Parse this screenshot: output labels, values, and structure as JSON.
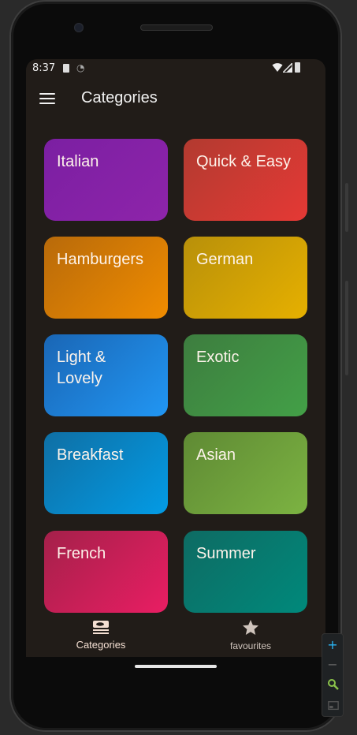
{
  "status_bar": {
    "time": "8:37"
  },
  "app_bar": {
    "title": "Categories",
    "menu_icon": "hamburger-menu-icon"
  },
  "categories": [
    {
      "label": "Italian",
      "color_from": "#7b1fa2",
      "color_to": "#8e24aa"
    },
    {
      "label": "Quick & Easy",
      "color_from": "#b23a30",
      "color_to": "#e53935"
    },
    {
      "label": "Hamburgers",
      "color_from": "#b86a0a",
      "color_to": "#f08c00"
    },
    {
      "label": "German",
      "color_from": "#b8900a",
      "color_to": "#e6b000"
    },
    {
      "label": "Light & Lovely",
      "color_from": "#1a66b5",
      "color_to": "#2196f3"
    },
    {
      "label": "Exotic",
      "color_from": "#3d7d3f",
      "color_to": "#43a047"
    },
    {
      "label": "Breakfast",
      "color_from": "#0f6fa4",
      "color_to": "#039be5"
    },
    {
      "label": "Asian",
      "color_from": "#5f8a34",
      "color_to": "#7cb342"
    },
    {
      "label": "French",
      "color_from": "#a4204a",
      "color_to": "#e91e63"
    },
    {
      "label": "Summer",
      "color_from": "#0e6b63",
      "color_to": "#00897b"
    }
  ],
  "bottom_nav": {
    "categories_label": "Categories",
    "categories_icon": "set-meal-icon",
    "favourites_label": "favourites",
    "favourites_icon": "star-icon",
    "active_color": "#f4dfd2"
  },
  "emulator_zoom": {
    "zoom_in": "+",
    "zoom_out": "−"
  }
}
